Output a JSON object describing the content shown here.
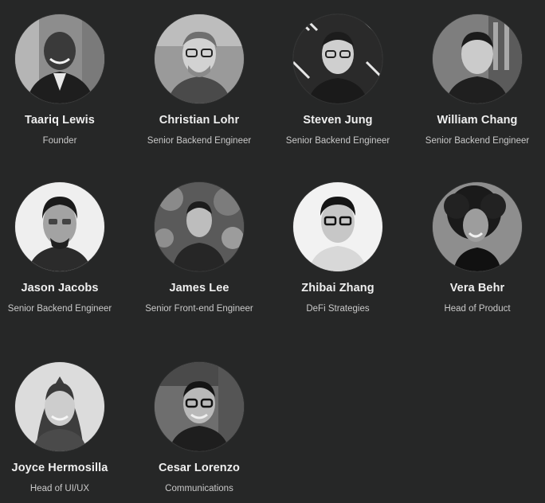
{
  "members": [
    {
      "name": "Taariq Lewis",
      "role": "Founder"
    },
    {
      "name": "Christian Lohr",
      "role": "Senior Backend Engineer"
    },
    {
      "name": "Steven Jung",
      "role": "Senior Backend Engineer"
    },
    {
      "name": "William Chang",
      "role": "Senior Backend Engineer"
    },
    {
      "name": "Jason Jacobs",
      "role": "Senior Backend Engineer"
    },
    {
      "name": "James Lee",
      "role": "Senior Front-end Engineer"
    },
    {
      "name": "Zhibai Zhang",
      "role": "DeFi Strategies"
    },
    {
      "name": "Vera Behr",
      "role": "Head of Product"
    },
    {
      "name": "Joyce Hermosilla",
      "role": "Head of UI/UX"
    },
    {
      "name": "Cesar Lorenzo",
      "role": "Communications"
    }
  ],
  "colors": {
    "background": "#262727",
    "name_text": "#efefef",
    "role_text": "#c9c9c9"
  }
}
